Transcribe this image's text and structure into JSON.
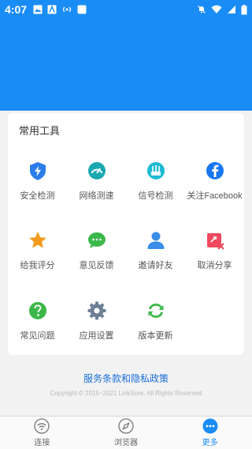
{
  "status_bar": {
    "time": "4:07"
  },
  "tools_card": {
    "title": "常用工具",
    "tools": [
      {
        "label": "安全检测",
        "icon": "shield-icon"
      },
      {
        "label": "网络测速",
        "icon": "speedometer-icon"
      },
      {
        "label": "信号检测",
        "icon": "router-icon"
      },
      {
        "label": "关注Facebook",
        "icon": "facebook-icon"
      },
      {
        "label": "给我评分",
        "icon": "star-icon"
      },
      {
        "label": "意见反馈",
        "icon": "chat-icon"
      },
      {
        "label": "邀请好友",
        "icon": "person-icon"
      },
      {
        "label": "取消分享",
        "icon": "share-cancel-icon"
      },
      {
        "label": "常见问题",
        "icon": "question-icon"
      },
      {
        "label": "应用设置",
        "icon": "gear-icon"
      },
      {
        "label": "版本更新",
        "icon": "refresh-icon"
      }
    ]
  },
  "footer": {
    "policy_link": "服务条款和隐私政策",
    "copyright": "Copyright © 2015~2021 LinkSure. All Rights Reserved"
  },
  "bottom_nav": {
    "items": [
      {
        "label": "连接",
        "icon": "wifi-icon",
        "active": false
      },
      {
        "label": "浏览器",
        "icon": "compass-icon",
        "active": false
      },
      {
        "label": "更多",
        "icon": "more-icon",
        "active": true
      }
    ]
  },
  "colors": {
    "accent": "#1a8cf5",
    "background": "#f2f2f2"
  }
}
